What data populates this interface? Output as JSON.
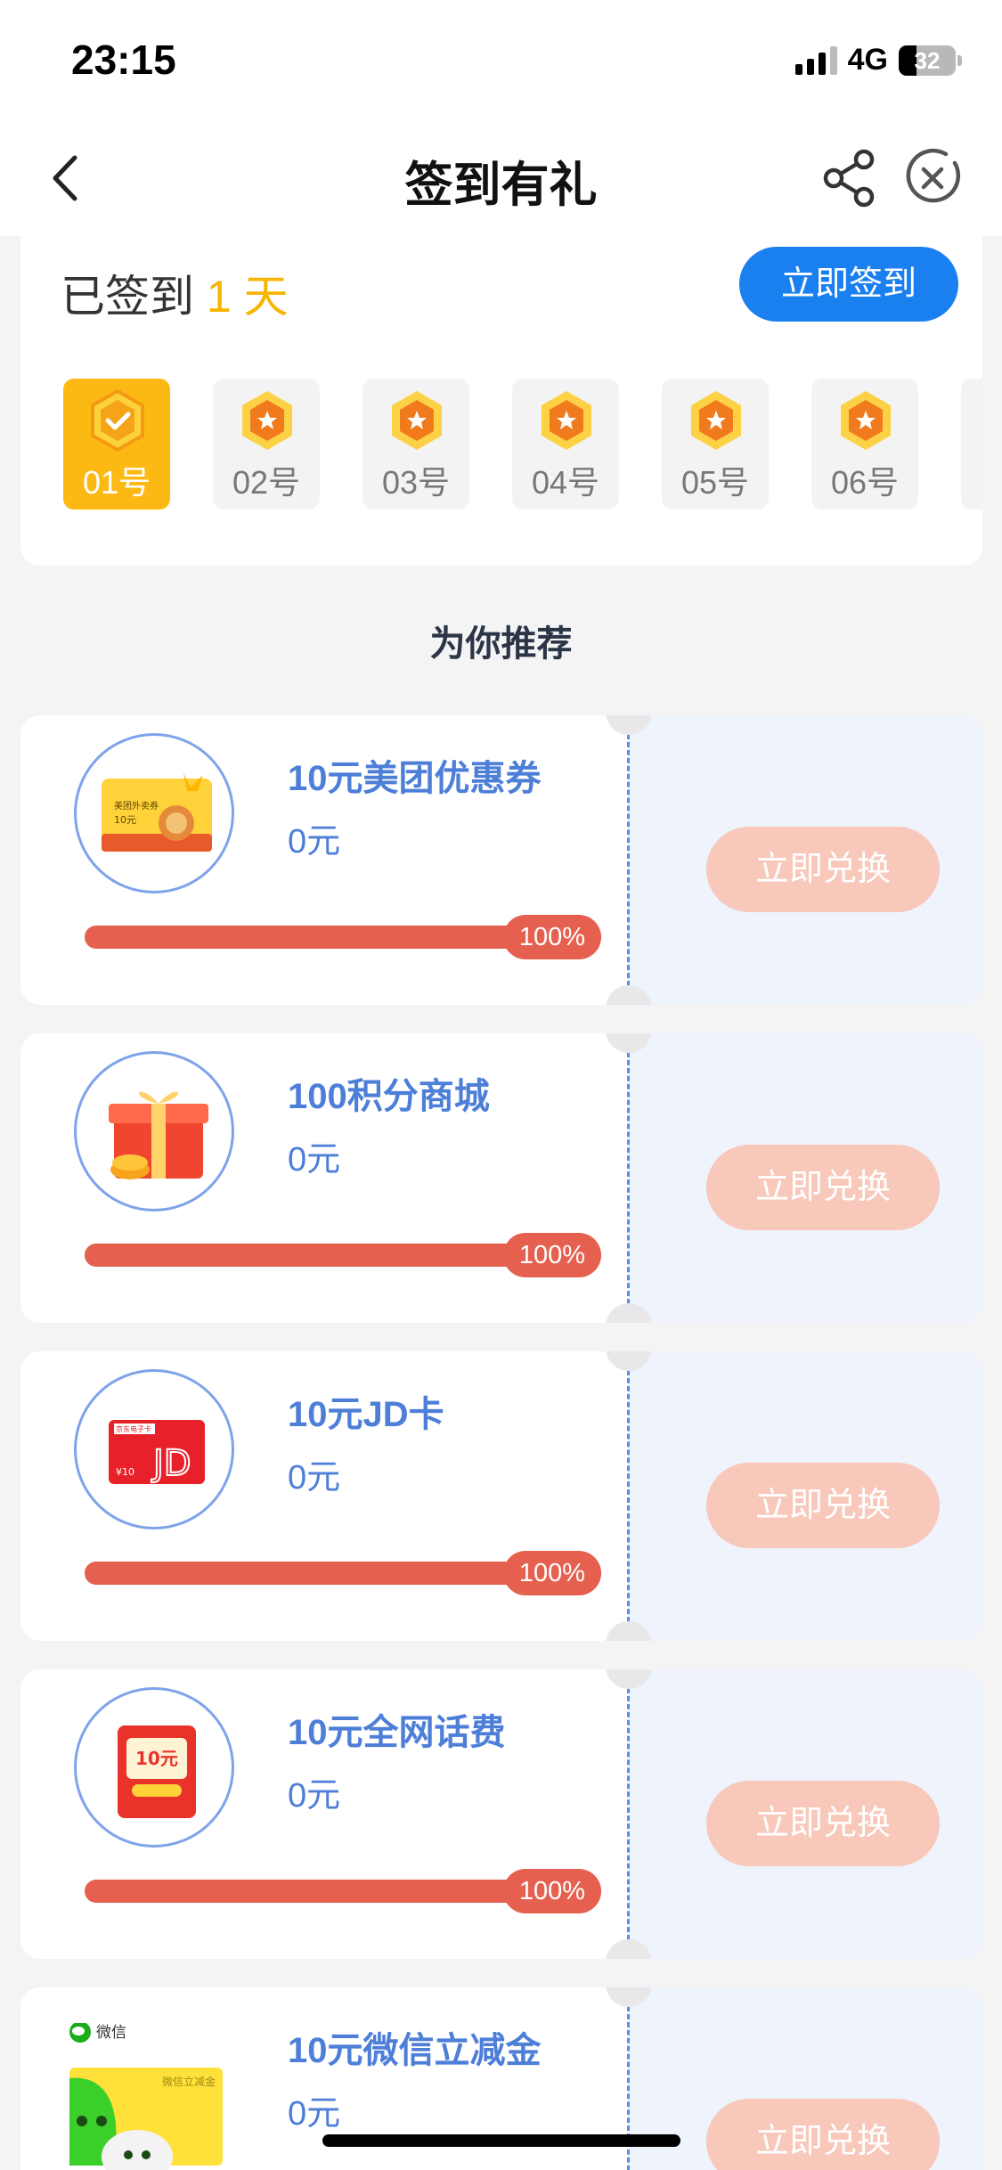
{
  "status": {
    "time": "23:15",
    "network": "4G",
    "battery": "32"
  },
  "nav": {
    "title": "签到有礼"
  },
  "checkin": {
    "label": "已签到",
    "days_value": "1",
    "days_unit": "天",
    "button": "立即签到",
    "days": [
      {
        "label": "01号",
        "checked": true
      },
      {
        "label": "02号",
        "checked": false
      },
      {
        "label": "03号",
        "checked": false
      },
      {
        "label": "04号",
        "checked": false
      },
      {
        "label": "05号",
        "checked": false
      },
      {
        "label": "06号",
        "checked": false
      }
    ]
  },
  "recommend": {
    "title": "为你推荐"
  },
  "rewards": [
    {
      "name": "10元美团优惠券",
      "price": "0元",
      "progress_label": "100%",
      "progress": 1.0,
      "button": "立即兑换",
      "icon": "meituan-coupon-card"
    },
    {
      "name": "100积分商城",
      "price": "0元",
      "progress_label": "100%",
      "progress": 1.0,
      "button": "立即兑换",
      "icon": "gift-box"
    },
    {
      "name": "10元JD卡",
      "price": "0元",
      "progress_label": "100%",
      "progress": 1.0,
      "button": "立即兑换",
      "icon": "jd-card"
    },
    {
      "name": "10元全网话费",
      "price": "0元",
      "progress_label": "100%",
      "progress": 1.0,
      "button": "立即兑换",
      "icon": "phone-credit-envelope"
    },
    {
      "name": "10元微信立减金",
      "price": "0元",
      "button": "立即兑换",
      "icon": "wechat-voucher-card",
      "icon_texts": {
        "brand": "微信",
        "card": "微信立减金"
      }
    }
  ],
  "thumb_texts": {
    "meituan_line1": "美团外卖券",
    "meituan_line2": "10元",
    "jd_header": "京东电子卡",
    "jd_amount": "¥10",
    "jd_logo": "JD",
    "phone_amount": "10元"
  },
  "colors": {
    "primary_blue": "#1a80f0",
    "gold": "#fdb913",
    "progress_red": "#e6604f",
    "redeem_pink": "#f8c8ba",
    "text_blue": "#4d7ed8"
  }
}
